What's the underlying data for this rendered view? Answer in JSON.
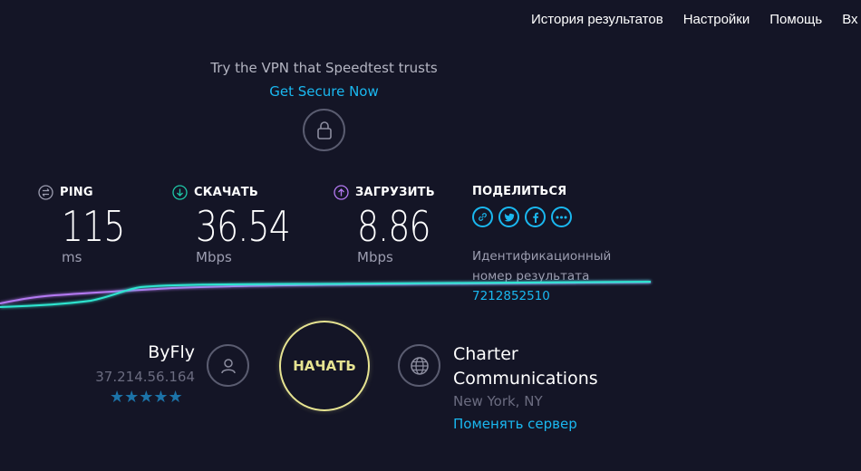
{
  "nav": {
    "items": [
      "История результатов",
      "Настройки",
      "Помощь",
      "Вх"
    ]
  },
  "promo": {
    "text": "Try the VPN that Speedtest trusts",
    "link": "Get Secure Now",
    "icon": "lock-icon"
  },
  "ping": {
    "label": "PING",
    "value": "115",
    "unit": "ms",
    "icon": "ping-icon"
  },
  "download": {
    "label": "СКАЧАТЬ",
    "value": "36.54",
    "unit": "Mbps",
    "icon": "download-arrow-icon",
    "color": "#1ec8a8"
  },
  "upload": {
    "label": "ЗАГРУЗИТЬ",
    "value": "8.86",
    "unit": "Mbps",
    "icon": "upload-arrow-icon",
    "color": "#b479f2"
  },
  "share": {
    "label": "ПОДЕЛИТЬСЯ",
    "icons": [
      "link-icon",
      "twitter-icon",
      "facebook-icon",
      "more-icon"
    ]
  },
  "result": {
    "label_line1": "Идентификационный",
    "label_line2": "номер результата",
    "id": "7212852510"
  },
  "isp": {
    "name": "ByFly",
    "ip": "37.214.56.164",
    "rating": 5,
    "stars": "★★★★★",
    "icon": "user-icon"
  },
  "start": {
    "label": "НАЧАТЬ",
    "color": "#e6e391"
  },
  "server": {
    "name_line1": "Charter",
    "name_line2": "Communications",
    "location": "New York, NY",
    "change": "Поменять сервер",
    "icon": "globe-icon"
  },
  "colors": {
    "background": "#141526",
    "accent": "#1ab8f0"
  }
}
